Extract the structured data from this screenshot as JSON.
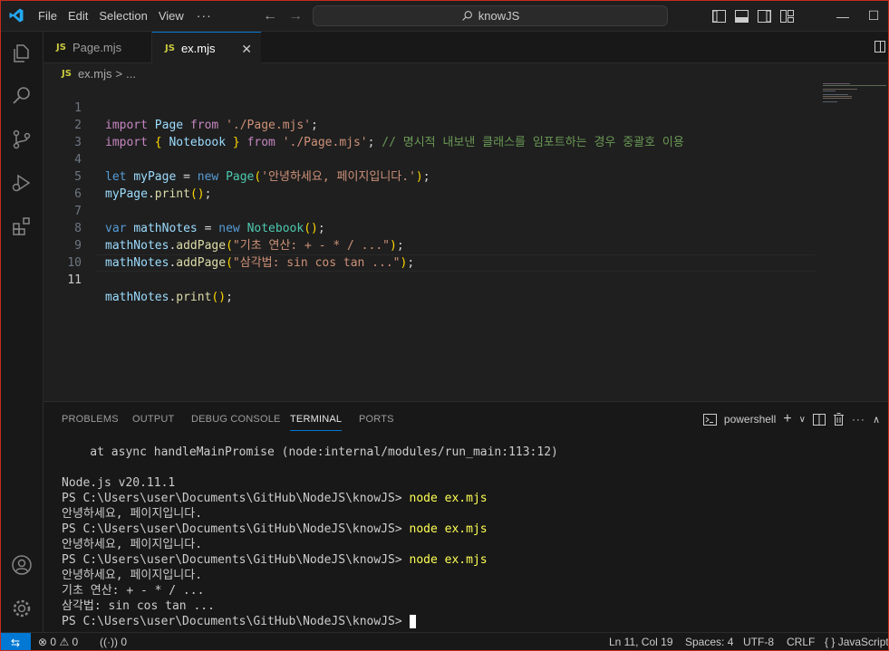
{
  "titlebar": {
    "menu": [
      "File",
      "Edit",
      "Selection",
      "View"
    ],
    "more": "···",
    "back_arrow": "←",
    "forward_arrow": "→",
    "search_text": "knowJS",
    "minimize": "—",
    "maximize": "☐"
  },
  "tabs": [
    {
      "icon": "JS",
      "label": "Page.mjs"
    },
    {
      "icon": "JS",
      "label": "ex.mjs",
      "close": "✕"
    }
  ],
  "breadcrumb": {
    "icon": "JS",
    "file": "ex.mjs",
    "sep": ">",
    "more": "..."
  },
  "editor": {
    "line_numbers": [
      "1",
      "2",
      "3",
      "4",
      "5",
      "6",
      "7",
      "8",
      "9",
      "10",
      "11"
    ],
    "active_line": 11
  },
  "panel": {
    "tabs": [
      "PROBLEMS",
      "OUTPUT",
      "DEBUG CONSOLE",
      "TERMINAL",
      "PORTS"
    ],
    "active_tab": "TERMINAL",
    "shell": "powershell",
    "add": "+",
    "chevron": "∨",
    "more": "···",
    "terminal_lines": [
      {
        "text": "    at async handleMainPromise (node:internal/modules/run_main:113:12)",
        "cmd": ""
      },
      {
        "text": "",
        "cmd": ""
      },
      {
        "text": "Node.js v20.11.1",
        "cmd": ""
      },
      {
        "text": "PS C:\\Users\\user\\Documents\\GitHub\\NodeJS\\knowJS> ",
        "cmd": "node ex.mjs"
      },
      {
        "text": "안녕하세요, 페이지입니다.",
        "cmd": ""
      },
      {
        "text": "PS C:\\Users\\user\\Documents\\GitHub\\NodeJS\\knowJS> ",
        "cmd": "node ex.mjs"
      },
      {
        "text": "안녕하세요, 페이지입니다.",
        "cmd": ""
      },
      {
        "text": "PS C:\\Users\\user\\Documents\\GitHub\\NodeJS\\knowJS> ",
        "cmd": "node ex.mjs"
      },
      {
        "text": "안녕하세요, 페이지입니다.",
        "cmd": ""
      },
      {
        "text": "기초 연산: + - * / ...",
        "cmd": ""
      },
      {
        "text": "삼각법: sin cos tan ...",
        "cmd": ""
      },
      {
        "text": "PS C:\\Users\\user\\Documents\\GitHub\\NodeJS\\knowJS> ",
        "cmd": ""
      }
    ]
  },
  "statusbar": {
    "remote_icon": "⇆",
    "errors": "0",
    "warnings": "0",
    "ports": "0",
    "position": "Ln 11, Col 19",
    "spaces": "Spaces: 4",
    "encoding": "UTF-8",
    "eol": "CRLF",
    "language_braces": "{ }",
    "language": "JavaScript"
  },
  "colors": {
    "accent": "#0078d4",
    "window_border": "#c42b1c",
    "js_icon": "#cbcb41"
  }
}
